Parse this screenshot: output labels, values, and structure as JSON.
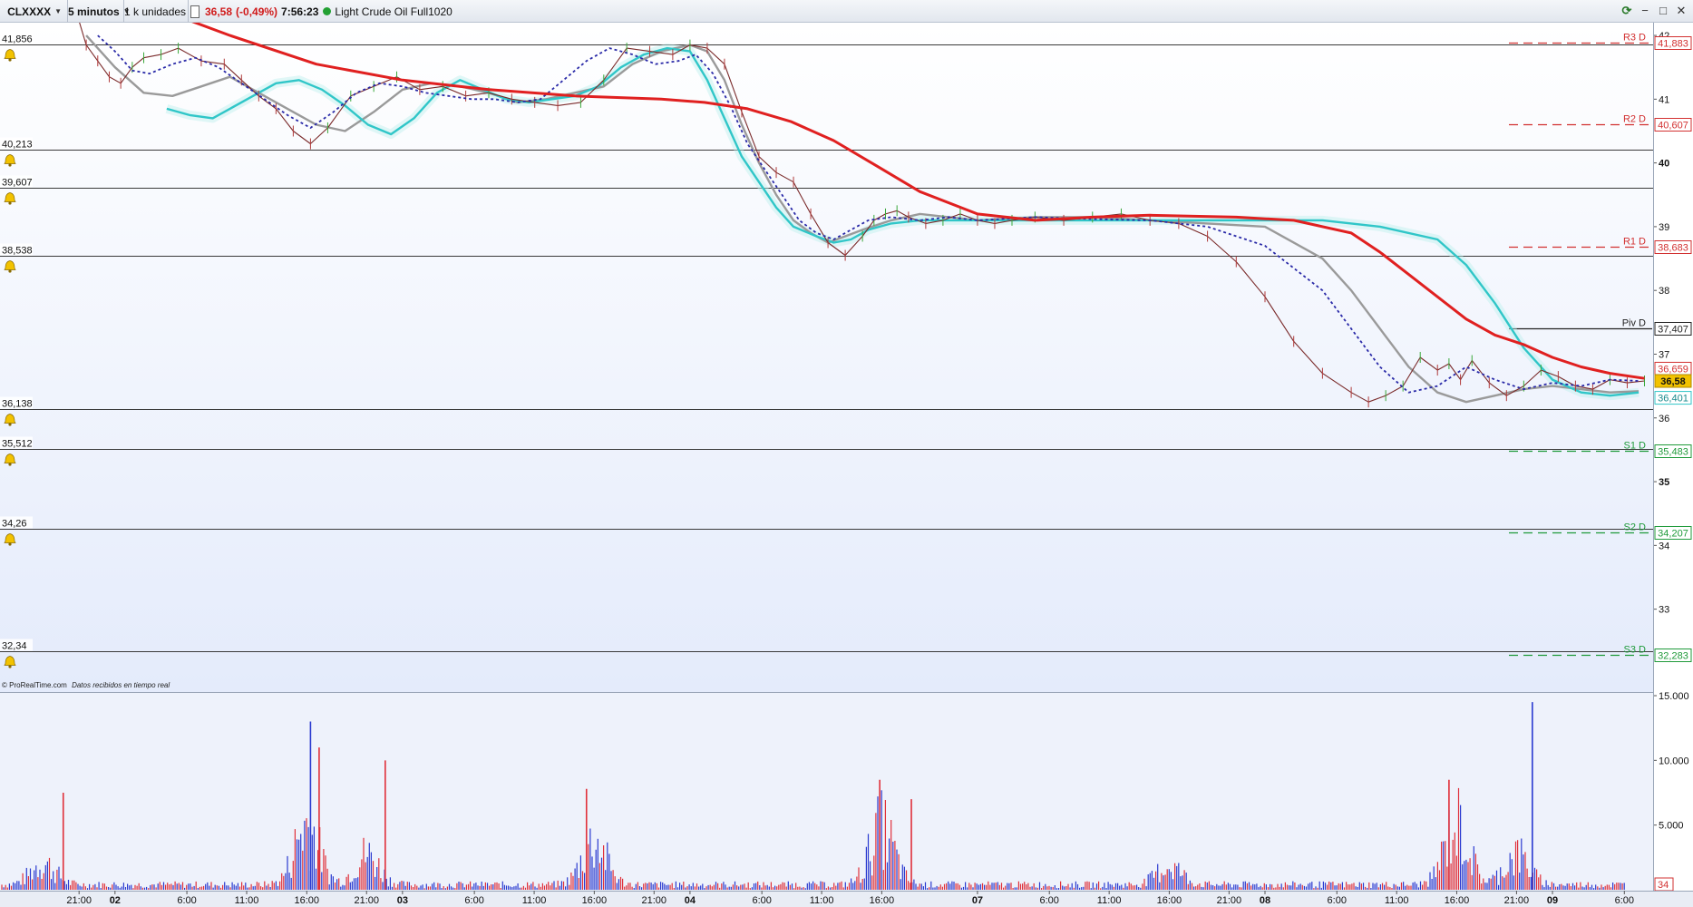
{
  "toolbar": {
    "symbol": "CLXXXX",
    "interval": "5 minutos",
    "units": "1 k unidades",
    "last_price": "36,58",
    "change": "(-0,49%)",
    "time": "7:56:23",
    "instrument": "Light Crude Oil Full1020",
    "status_color": "#22a033",
    "refresh_icon": "refresh-icon",
    "minimize_icon": "minimize-icon",
    "maximize_icon": "maximize-icon",
    "close_icon": "close-icon"
  },
  "footer": {
    "source_brand": "© ProRealTime.com",
    "source_note": "Datos recibidos en tiempo real"
  },
  "colors": {
    "sma_long": "#e02020",
    "sma_mid": "#9a9a9a",
    "ma_fast": "#30c6c8",
    "ma_dotted": "#2a2aa8",
    "pivot_resistance": "#d23030",
    "pivot_support": "#1f9a3a",
    "pivot": "#222222",
    "volume_up": "#e0303a",
    "volume_down": "#2a3ad0"
  },
  "chart_data": {
    "type": "line",
    "ylim": [
      31.7,
      42.2
    ],
    "y_ticks": [
      {
        "value": 42,
        "label": "42"
      },
      {
        "value": 41,
        "label": "41"
      },
      {
        "value": 40,
        "label": "40",
        "bold": true
      },
      {
        "value": 39,
        "label": "39"
      },
      {
        "value": 38,
        "label": "38"
      },
      {
        "value": 37,
        "label": "37"
      },
      {
        "value": 36,
        "label": "36"
      },
      {
        "value": 35,
        "label": "35",
        "bold": true
      },
      {
        "value": 34,
        "label": "34"
      },
      {
        "value": 33,
        "label": "33"
      }
    ],
    "x_domain": [
      -0.4,
      5.35
    ],
    "x_ticks": [
      {
        "t": -0.125,
        "label": "21:00"
      },
      {
        "t": 0.0,
        "label": "02",
        "bold": true
      },
      {
        "t": 0.25,
        "label": "6:00"
      },
      {
        "t": 0.458,
        "label": "11:00"
      },
      {
        "t": 0.667,
        "label": "16:00"
      },
      {
        "t": 0.875,
        "label": "21:00"
      },
      {
        "t": 1.0,
        "label": "03",
        "bold": true
      },
      {
        "t": 1.25,
        "label": "6:00"
      },
      {
        "t": 1.458,
        "label": "11:00"
      },
      {
        "t": 1.667,
        "label": "16:00"
      },
      {
        "t": 1.875,
        "label": "21:00"
      },
      {
        "t": 2.0,
        "label": "04",
        "bold": true
      },
      {
        "t": 2.25,
        "label": "6:00"
      },
      {
        "t": 2.458,
        "label": "11:00"
      },
      {
        "t": 2.667,
        "label": "16:00"
      },
      {
        "t": 3.0,
        "label": "07",
        "bold": true
      },
      {
        "t": 3.25,
        "label": "6:00"
      },
      {
        "t": 3.458,
        "label": "11:00"
      },
      {
        "t": 3.667,
        "label": "16:00"
      },
      {
        "t": 3.875,
        "label": "21:00"
      },
      {
        "t": 4.0,
        "label": "08",
        "bold": true
      },
      {
        "t": 4.25,
        "label": "6:00"
      },
      {
        "t": 4.458,
        "label": "11:00"
      },
      {
        "t": 4.667,
        "label": "16:00"
      },
      {
        "t": 4.875,
        "label": "21:00"
      },
      {
        "t": 5.0,
        "label": "09",
        "bold": true
      },
      {
        "t": 5.25,
        "label": "6:00"
      }
    ],
    "alert_levels": [
      {
        "value": 41.856,
        "label": "41,856"
      },
      {
        "value": 40.213,
        "label": "40,213"
      },
      {
        "value": 39.607,
        "label": "39,607"
      },
      {
        "value": 38.538,
        "label": "38,538"
      },
      {
        "value": 36.138,
        "label": "36,138"
      },
      {
        "value": 35.512,
        "label": "35,512"
      },
      {
        "value": 34.26,
        "label": "34,26"
      },
      {
        "value": 32.34,
        "label": "32,34"
      }
    ],
    "pivots": [
      {
        "name": "R3 D",
        "value": 41.883,
        "label": "41,883",
        "kind": "resistance"
      },
      {
        "name": "R2 D",
        "value": 40.607,
        "label": "40,607",
        "kind": "resistance"
      },
      {
        "name": "R1 D",
        "value": 38.683,
        "label": "38,683",
        "kind": "resistance"
      },
      {
        "name": "Piv D",
        "value": 37.407,
        "label": "37,407",
        "kind": "pivot"
      },
      {
        "name": "S1 D",
        "value": 35.483,
        "label": "35,483",
        "kind": "support"
      },
      {
        "name": "S2 D",
        "value": 34.207,
        "label": "34,207",
        "kind": "support"
      },
      {
        "name": "S3 D",
        "value": 32.283,
        "label": "32,283",
        "kind": "support"
      }
    ],
    "price_labels": [
      {
        "value": 36.659,
        "label": "36,659",
        "kind": "red"
      },
      {
        "value": 36.58,
        "label": "36,58",
        "kind": "current"
      },
      {
        "value": 36.401,
        "label": "36,401",
        "kind": "cyan"
      }
    ],
    "series": [
      {
        "key": "price",
        "x": [
          -0.13,
          -0.1,
          -0.06,
          -0.02,
          0.02,
          0.06,
          0.1,
          0.16,
          0.22,
          0.3,
          0.38,
          0.44,
          0.5,
          0.56,
          0.62,
          0.68,
          0.74,
          0.82,
          0.9,
          0.98,
          1.06,
          1.14,
          1.22,
          1.3,
          1.38,
          1.46,
          1.54,
          1.62,
          1.7,
          1.78,
          1.86,
          1.94,
          2.0,
          2.06,
          2.12,
          2.18,
          2.24,
          2.3,
          2.36,
          2.42,
          2.48,
          2.54,
          2.6,
          2.64,
          2.68,
          2.72,
          2.76,
          2.82,
          2.88,
          2.94,
          3.0,
          3.06,
          3.12,
          3.2,
          3.3,
          3.4,
          3.5,
          3.6,
          3.7,
          3.8,
          3.9,
          4.0,
          4.1,
          4.2,
          4.3,
          4.36,
          4.42,
          4.48,
          4.54,
          4.6,
          4.64,
          4.68,
          4.72,
          4.78,
          4.84,
          4.9,
          4.96,
          5.02,
          5.08,
          5.14,
          5.2,
          5.26,
          5.32
        ],
        "values": [
          42.3,
          41.85,
          41.6,
          41.35,
          41.25,
          41.5,
          41.65,
          41.7,
          41.8,
          41.6,
          41.55,
          41.3,
          41.05,
          40.85,
          40.5,
          40.3,
          40.55,
          41.05,
          41.2,
          41.35,
          41.15,
          41.2,
          41.05,
          41.1,
          41.0,
          40.95,
          40.9,
          40.95,
          41.3,
          41.8,
          41.75,
          41.7,
          41.85,
          41.8,
          41.55,
          40.8,
          40.1,
          39.85,
          39.7,
          39.2,
          38.75,
          38.55,
          38.85,
          39.1,
          39.2,
          39.25,
          39.15,
          39.05,
          39.1,
          39.2,
          39.1,
          39.05,
          39.1,
          39.15,
          39.1,
          39.15,
          39.2,
          39.1,
          39.05,
          38.85,
          38.45,
          37.9,
          37.2,
          36.7,
          36.4,
          36.25,
          36.35,
          36.5,
          36.95,
          36.75,
          36.85,
          36.6,
          36.9,
          36.55,
          36.35,
          36.5,
          36.75,
          36.65,
          36.5,
          36.45,
          36.6,
          36.55,
          36.58
        ]
      },
      {
        "key": "sma_long",
        "x": [
          -0.4,
          0.1,
          0.4,
          0.7,
          1.0,
          1.3,
          1.6,
          1.9,
          2.05,
          2.2,
          2.35,
          2.5,
          2.65,
          2.8,
          3.0,
          3.2,
          3.4,
          3.6,
          3.9,
          4.1,
          4.3,
          4.4,
          4.5,
          4.6,
          4.7,
          4.8,
          4.9,
          5.0,
          5.1,
          5.2,
          5.32
        ],
        "values": [
          43.3,
          42.5,
          42.0,
          41.55,
          41.3,
          41.15,
          41.05,
          41.0,
          40.95,
          40.85,
          40.65,
          40.35,
          39.95,
          39.55,
          39.2,
          39.1,
          39.15,
          39.18,
          39.15,
          39.1,
          38.9,
          38.6,
          38.25,
          37.9,
          37.55,
          37.3,
          37.15,
          36.95,
          36.8,
          36.7,
          36.62
        ]
      },
      {
        "key": "sma_mid",
        "x": [
          -0.1,
          0.0,
          0.1,
          0.2,
          0.3,
          0.4,
          0.5,
          0.6,
          0.7,
          0.8,
          0.9,
          1.0,
          1.1,
          1.2,
          1.3,
          1.4,
          1.5,
          1.6,
          1.7,
          1.8,
          1.9,
          2.0,
          2.06,
          2.12,
          2.18,
          2.24,
          2.3,
          2.36,
          2.42,
          2.48,
          2.54,
          2.6,
          2.7,
          2.8,
          2.9,
          3.0,
          3.2,
          3.4,
          3.6,
          3.8,
          4.0,
          4.2,
          4.3,
          4.4,
          4.5,
          4.6,
          4.7,
          4.8,
          4.9,
          5.0,
          5.1,
          5.2,
          5.3
        ],
        "values": [
          42.0,
          41.5,
          41.1,
          41.05,
          41.2,
          41.35,
          41.1,
          40.85,
          40.6,
          40.5,
          40.8,
          41.15,
          41.25,
          41.2,
          41.1,
          40.95,
          41.0,
          41.1,
          41.2,
          41.55,
          41.75,
          41.85,
          41.75,
          41.3,
          40.6,
          40.0,
          39.5,
          39.1,
          38.9,
          38.75,
          38.85,
          38.95,
          39.1,
          39.2,
          39.15,
          39.1,
          39.15,
          39.15,
          39.1,
          39.05,
          39.0,
          38.5,
          38.0,
          37.4,
          36.8,
          36.4,
          36.25,
          36.35,
          36.45,
          36.5,
          36.45,
          36.4,
          36.42
        ]
      },
      {
        "key": "ma_fast",
        "x": [
          0.18,
          0.26,
          0.34,
          0.4,
          0.48,
          0.56,
          0.64,
          0.72,
          0.8,
          0.88,
          0.96,
          1.04,
          1.12,
          1.2,
          1.28,
          1.36,
          1.44,
          1.52,
          1.6,
          1.68,
          1.76,
          1.84,
          1.92,
          2.0,
          2.06,
          2.12,
          2.18,
          2.24,
          2.3,
          2.36,
          2.44,
          2.5,
          2.56,
          2.62,
          2.7,
          2.8,
          2.9,
          3.0,
          3.2,
          3.4,
          3.6,
          3.8,
          4.0,
          4.2,
          4.4,
          4.6,
          4.7,
          4.8,
          4.9,
          5.0,
          5.1,
          5.2,
          5.3
        ],
        "values": [
          40.85,
          40.75,
          40.7,
          40.85,
          41.05,
          41.25,
          41.3,
          41.15,
          40.9,
          40.6,
          40.45,
          40.7,
          41.1,
          41.3,
          41.15,
          41.0,
          40.95,
          41.0,
          41.05,
          41.2,
          41.5,
          41.7,
          41.8,
          41.75,
          41.3,
          40.7,
          40.1,
          39.7,
          39.3,
          39.0,
          38.85,
          38.75,
          38.8,
          38.95,
          39.05,
          39.1,
          39.1,
          39.1,
          39.1,
          39.1,
          39.1,
          39.1,
          39.1,
          39.1,
          39.0,
          38.8,
          38.4,
          37.8,
          37.1,
          36.6,
          36.4,
          36.35,
          36.4
        ]
      },
      {
        "key": "ma_dotted",
        "x": [
          -0.06,
          0.0,
          0.06,
          0.12,
          0.2,
          0.28,
          0.36,
          0.44,
          0.52,
          0.6,
          0.68,
          0.76,
          0.84,
          0.92,
          1.0,
          1.08,
          1.16,
          1.24,
          1.32,
          1.4,
          1.48,
          1.56,
          1.64,
          1.72,
          1.8,
          1.88,
          1.96,
          2.02,
          2.08,
          2.14,
          2.2,
          2.26,
          2.32,
          2.38,
          2.44,
          2.5,
          2.56,
          2.62,
          2.7,
          2.8,
          2.9,
          3.0,
          3.2,
          3.4,
          3.6,
          3.8,
          4.0,
          4.2,
          4.3,
          4.4,
          4.5,
          4.6,
          4.7,
          4.8,
          4.9,
          5.0,
          5.1,
          5.2,
          5.3
        ],
        "values": [
          42.0,
          41.75,
          41.45,
          41.4,
          41.55,
          41.65,
          41.5,
          41.25,
          41.0,
          40.75,
          40.55,
          40.8,
          41.1,
          41.25,
          41.2,
          41.1,
          41.05,
          41.0,
          41.0,
          40.95,
          41.0,
          41.3,
          41.6,
          41.8,
          41.7,
          41.55,
          41.6,
          41.7,
          41.4,
          40.9,
          40.3,
          39.9,
          39.5,
          39.1,
          38.9,
          38.8,
          38.95,
          39.1,
          39.15,
          39.1,
          39.15,
          39.1,
          39.15,
          39.12,
          39.1,
          39.0,
          38.7,
          38.0,
          37.4,
          36.8,
          36.4,
          36.5,
          36.8,
          36.6,
          36.45,
          36.55,
          36.5,
          36.6,
          36.58
        ]
      }
    ],
    "volume": {
      "ylim": [
        0,
        15000
      ],
      "ticks": [
        {
          "value": 15000,
          "label": "15.000"
        },
        {
          "value": 10000,
          "label": "10.000"
        },
        {
          "value": 5000,
          "label": "5.000"
        },
        {
          "value": 34,
          "label": "34"
        }
      ],
      "clusters": [
        {
          "t": -0.25,
          "level": 2500
        },
        {
          "t": 0.667,
          "level": 7000
        },
        {
          "t": 0.875,
          "level": 3500
        },
        {
          "t": 1.667,
          "level": 5000
        },
        {
          "t": 2.667,
          "level": 6500
        },
        {
          "t": 3.667,
          "level": 2200
        },
        {
          "t": 4.667,
          "level": 7000
        },
        {
          "t": 4.875,
          "level": 3500
        }
      ],
      "peaks": [
        {
          "t": 0.68,
          "value": 13000
        },
        {
          "t": 0.71,
          "value": 11000
        },
        {
          "t": 0.94,
          "value": 10000
        },
        {
          "t": -0.18,
          "value": 7500
        },
        {
          "t": 1.64,
          "value": 7800
        },
        {
          "t": 2.66,
          "value": 8500
        },
        {
          "t": 2.77,
          "value": 7000
        },
        {
          "t": 4.64,
          "value": 8500
        },
        {
          "t": 4.93,
          "value": 14500
        }
      ],
      "last_value": "34"
    }
  }
}
